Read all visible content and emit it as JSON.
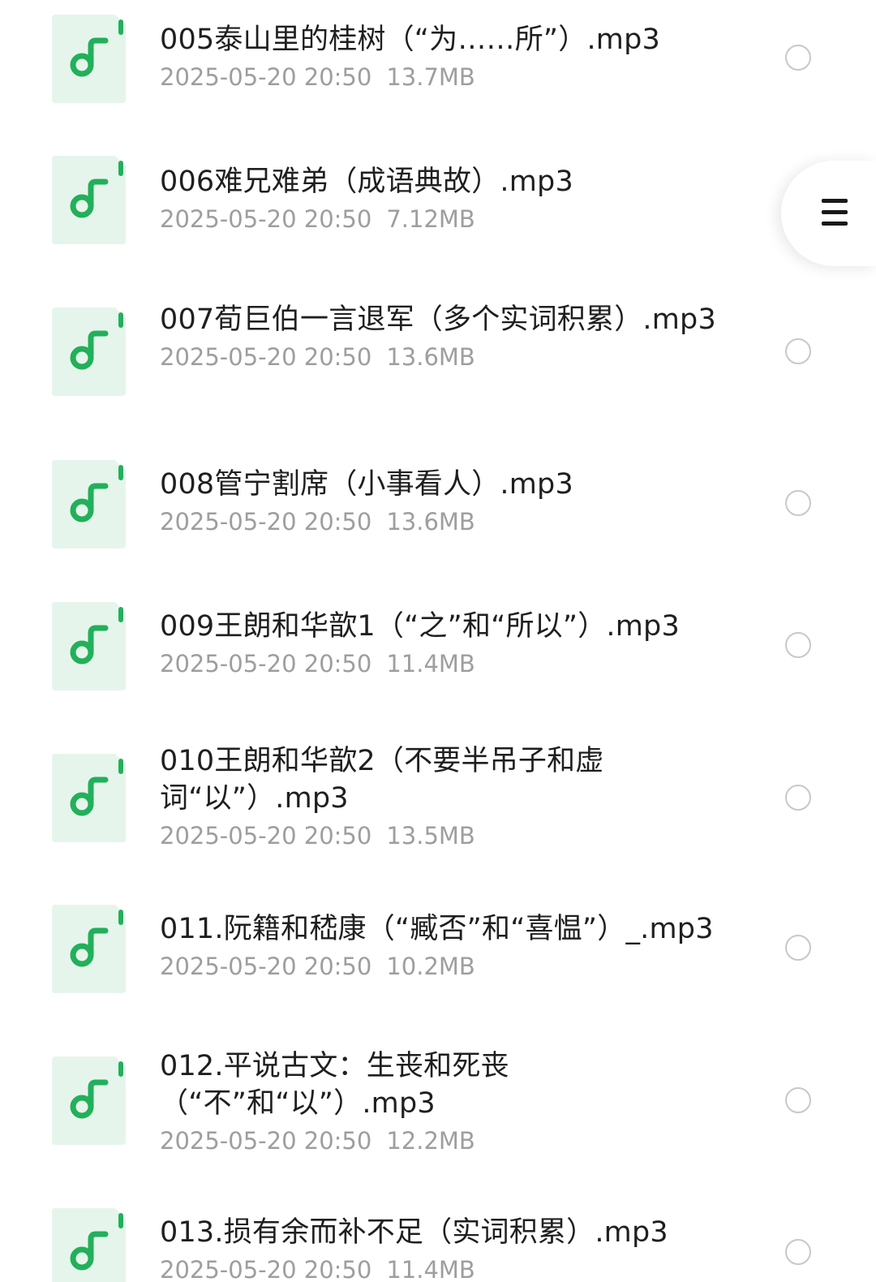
{
  "files": [
    {
      "name": "005泰山里的桂树（“为……所”）.mp3",
      "date": "2025-05-20 20:50",
      "size": "13.7MB",
      "icon": "music-note-icon"
    },
    {
      "name": "006难兄难弟（成语典故）.mp3",
      "date": "2025-05-20 20:50",
      "size": "7.12MB",
      "icon": "music-note-icon"
    },
    {
      "name": "007荀巨伯一言退军（多个实词积累）.mp3",
      "date": "2025-05-20 20:50",
      "size": "13.6MB",
      "icon": "music-note-icon"
    },
    {
      "name": "008管宁割席（小事看人）.mp3",
      "date": "2025-05-20 20:50",
      "size": "13.6MB",
      "icon": "music-note-icon"
    },
    {
      "name": "009王朗和华歆1（“之”和“所以”）.mp3",
      "date": "2025-05-20 20:50",
      "size": "11.4MB",
      "icon": "music-note-icon"
    },
    {
      "name": "010王朗和华歆2（不要半吊子和虚词“以”）.mp3",
      "date": "2025-05-20 20:50",
      "size": "13.5MB",
      "icon": "music-note-icon"
    },
    {
      "name": "011.阮籍和嵇康（“臧否”和“喜愠”）_.mp3",
      "date": "2025-05-20 20:50",
      "size": "10.2MB",
      "icon": "music-note-icon"
    },
    {
      "name": "012.平说古文：生丧和死丧（“不”和“以”）.mp3",
      "date": "2025-05-20 20:50",
      "size": "12.2MB",
      "icon": "music-note-icon"
    },
    {
      "name": "013.损有余而补不足（实词积累）.mp3",
      "date": "2025-05-20 20:50",
      "size": "11.4MB",
      "icon": "music-note-icon"
    }
  ],
  "menu_button": {
    "icon": "hamburger-menu-icon"
  },
  "colors": {
    "icon_bg": "#e6f5ec",
    "icon_accent": "#22b05a",
    "title_text": "#1f1f1f",
    "meta_text": "#9e9e9e",
    "radio_border": "#c8c8c8"
  }
}
